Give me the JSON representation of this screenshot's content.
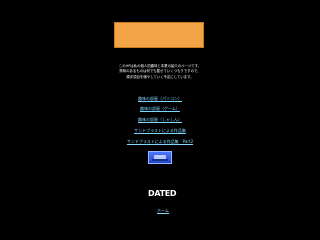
{
  "colors": {
    "background": "#000000",
    "banner_fill": "#f3a447",
    "link": "#7fd6ff",
    "text": "#f7f7f7",
    "thumb_blue": "#3a63f0"
  },
  "intro": {
    "line1": "このHPは私の個人的趣味と本業の紹介のページです。",
    "line2": "興味のあるものは何でも載せていくつもりですので、",
    "line3": "順次項目を増やしていく予定にしています。"
  },
  "links": [
    {
      "label": "趣味の部屋（パソコン）"
    },
    {
      "label": "趣味の部屋（ゲーム）"
    },
    {
      "label": "趣味の部屋（しゃしん）"
    },
    {
      "label": "サンドブラストによる作品集"
    },
    {
      "label": "サンドブラストによる作品集　Part2"
    }
  ],
  "badge": {
    "text": "DATED"
  },
  "footer": {
    "link_label": "ホーム"
  }
}
